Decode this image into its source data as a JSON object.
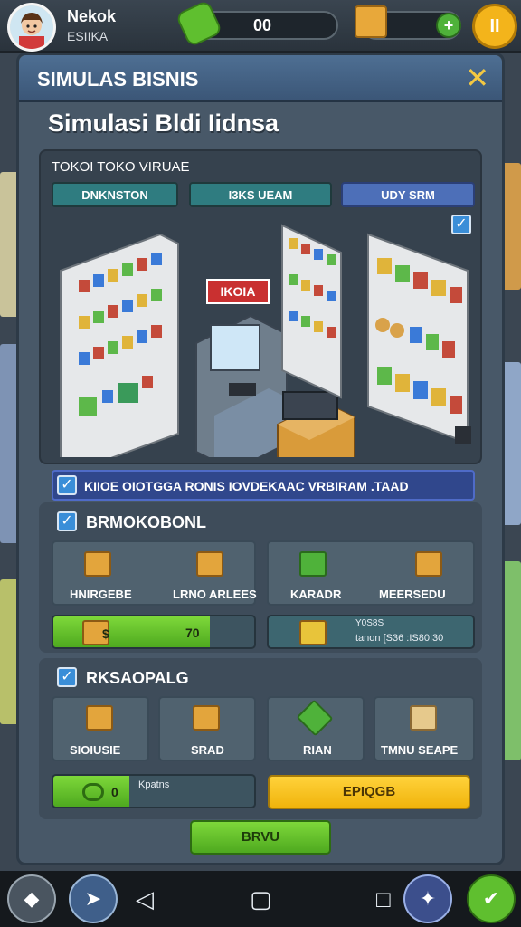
{
  "player": {
    "name": "Nekok",
    "sub": "ESIIKA"
  },
  "currency": {
    "cash_value": "00",
    "plus": "+",
    "pause": "II"
  },
  "panel": {
    "title": "SIMULAS BISNIS",
    "close": "✕",
    "subtitle": "Simulasi Bldi Iidnsa",
    "store_label": "TOKOI TOKO VIRUAE",
    "tabs": [
      "DNKNSTON",
      "I3KS UEAM",
      "UDY SRM"
    ],
    "scene_sign": "IKOIA",
    "info_text": "KIIOE OIOTGGA RONIS IOVDEKAAC VRBIRAM .TAAD"
  },
  "section1": {
    "title": "BRMOKOBONL",
    "cards": [
      "HNIRGEBE",
      "LRNO ARLEES",
      "KARADR",
      "MEERSEDU"
    ],
    "progress_icon_label": "$",
    "progress_value": "70",
    "progress_fraction": 0.78,
    "stats_line1": "Y0S8S",
    "stats_line2": "tanon  [S36 :IS80I30"
  },
  "section2": {
    "title": "RKSAOPALG",
    "cards": [
      "SIOIUSIE",
      "SRAD",
      "RIAN",
      "TMNU SEAPE"
    ],
    "progress_label": "0",
    "progress_text": "Kpatns",
    "progress_fraction": 0.38,
    "yellow_button": "EPIQGB"
  },
  "bottom_button": "BRVU",
  "colors": {
    "accent_green": "#5fbf2f",
    "accent_yellow": "#f3b41b",
    "panel_blue": "#4e6f93",
    "tab_teal": "#2f7c80"
  },
  "icons": [
    "cash-icon",
    "box-icon",
    "plus-icon",
    "pause-icon",
    "close-icon",
    "checkbox-icon",
    "crate-icon",
    "nav-back-icon",
    "nav-home-icon",
    "nav-recent-icon"
  ]
}
